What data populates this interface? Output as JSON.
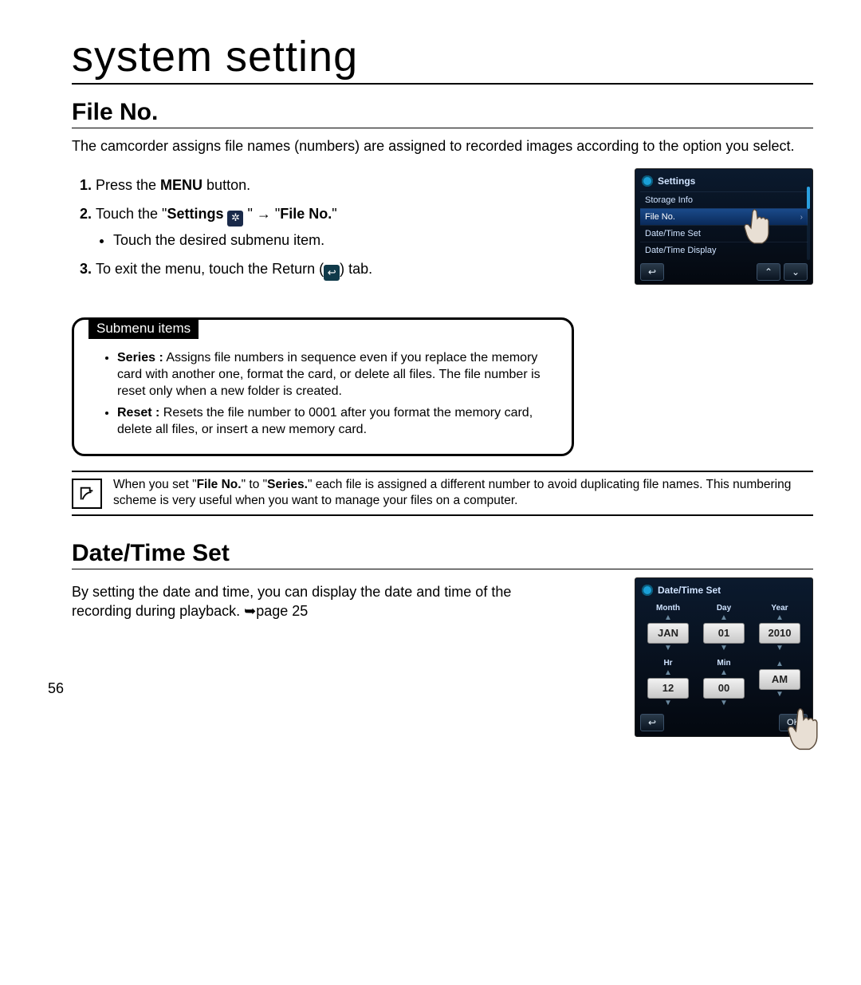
{
  "chapter_title": "system setting",
  "section1": {
    "title": "File No.",
    "intro": "The camcorder assigns file names (numbers) are assigned to recorded images according to the option you select.",
    "steps": {
      "s1_a": "Press the ",
      "s1_b": "MENU",
      "s1_c": " button.",
      "s2_a": "Touch the \"",
      "s2_b": "Settings",
      "s2_c": " \" → \"",
      "s2_d": "File No.",
      "s2_e": "\"",
      "s2_sub": "Touch the desired submenu item.",
      "s3_a": "To exit the menu, touch the Return (",
      "s3_b": ") tab."
    },
    "submenu": {
      "label": "Submenu items",
      "series_name": "Series :",
      "series_desc": " Assigns file numbers in sequence even if you replace the memory card with another one, format the card, or delete all files. The file number is reset only when a new folder is created.",
      "reset_name": "Reset :",
      "reset_desc": " Resets the file number to 0001 after you format the memory card, delete all files, or insert a new memory card."
    },
    "note": "When you set \"File No.\" to \"Series.\" each file is assigned a different number to avoid duplicating file names. This numbering scheme is very useful when you want to manage your files on a computer.",
    "note_b1": "File No.",
    "note_b2": "Series."
  },
  "section2": {
    "title": "Date/Time Set",
    "intro": "By setting the date and time, you can display the date and time of the recording during playback. ➥page 25"
  },
  "page_number": "56",
  "device1": {
    "header": "Settings",
    "items": [
      "Storage Info",
      "File No.",
      "Date/Time Set",
      "Date/Time Display"
    ],
    "selected_index": 1
  },
  "device2": {
    "header": "Date/Time Set",
    "row1_labels": [
      "Month",
      "Day",
      "Year"
    ],
    "row1_values": [
      "JAN",
      "01",
      "2010"
    ],
    "row2_labels": [
      "Hr",
      "Min",
      ""
    ],
    "row2_values": [
      "12",
      "00",
      "AM"
    ],
    "ok": "OK"
  }
}
